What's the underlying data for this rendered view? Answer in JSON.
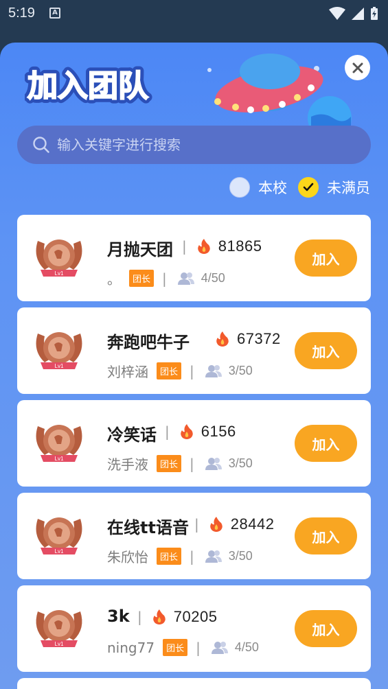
{
  "status_bar": {
    "time": "5:19"
  },
  "header": {
    "title": "加入团队"
  },
  "search": {
    "placeholder": "输入关键字进行搜索"
  },
  "filters": [
    {
      "label": "本校",
      "checked": false
    },
    {
      "label": "未满员",
      "checked": true
    }
  ],
  "teams": [
    {
      "name": "月抛天团",
      "score": "81865",
      "leader": "。",
      "role": "团长",
      "members": "4/50",
      "level": "Lv1",
      "action": "加入"
    },
    {
      "name": "奔跑吧牛子",
      "score": "67372",
      "leader": "刘梓涵",
      "role": "团长",
      "members": "3/50",
      "level": "Lv1",
      "action": "加入"
    },
    {
      "name": "冷笑话",
      "score": "6156",
      "leader": "洗手液",
      "role": "团长",
      "members": "3/50",
      "level": "Lv1",
      "action": "加入"
    },
    {
      "name": "在线tt语音",
      "score": "28442",
      "leader": "朱欣怡",
      "role": "团长",
      "members": "3/50",
      "level": "Lv1",
      "action": "加入"
    },
    {
      "name": "3k",
      "score": "70205",
      "leader": "ning77",
      "role": "团长",
      "members": "4/50",
      "level": "Lv1",
      "action": "加入"
    }
  ],
  "colors": {
    "accent": "#f9a622",
    "tag": "#fb8c1a",
    "sheet": "#4c87f5"
  }
}
